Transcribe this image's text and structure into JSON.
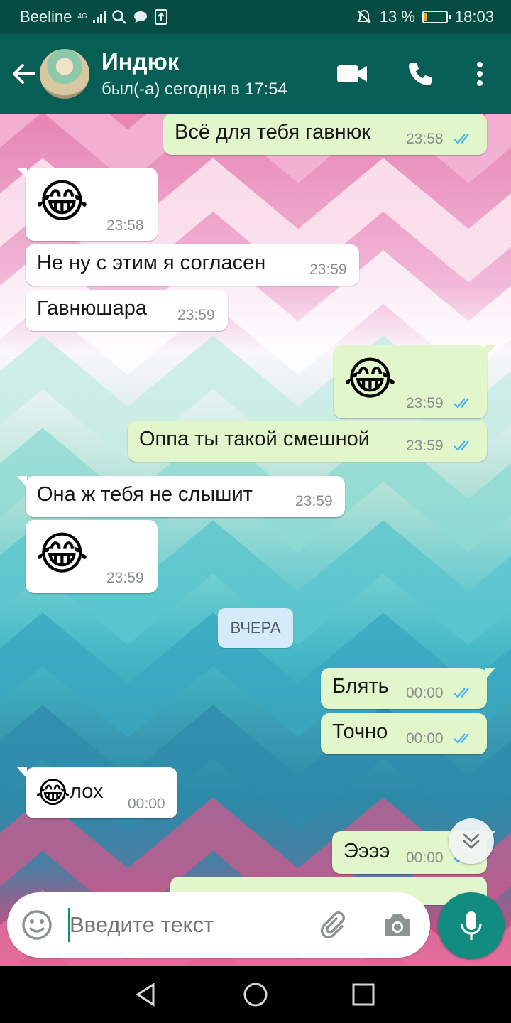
{
  "status_bar": {
    "carrier": "Beeline",
    "network": "4G",
    "battery_percent": "13 %",
    "battery_level": 0.13,
    "time": "18:03"
  },
  "header": {
    "contact_name": "Индюк",
    "contact_status": "был(-а) сегодня в 17:54",
    "icons": [
      "back-arrow-icon",
      "video-call-icon",
      "phone-call-icon",
      "more-vert-icon"
    ]
  },
  "messages": [
    {
      "dir": "out",
      "text": "Всё для тебя гавнюк",
      "time": "23:58",
      "read": true
    },
    {
      "dir": "in",
      "emoji": "😂",
      "time": "23:58"
    },
    {
      "dir": "in",
      "text": "Не ну с этим я согласен",
      "time": "23:59"
    },
    {
      "dir": "in",
      "text": "Гавнюшара",
      "time": "23:59"
    },
    {
      "dir": "out",
      "emoji": "😂",
      "time": "23:59",
      "read": true
    },
    {
      "dir": "out",
      "text": "Оппа ты такой смешной",
      "time": "23:59",
      "read": true
    },
    {
      "dir": "in",
      "text": "Она ж тебя не слышит",
      "time": "23:59"
    },
    {
      "dir": "in",
      "emoji": "😂",
      "time": "23:59"
    },
    {
      "dir": "out",
      "text": "Блять",
      "time": "00:00",
      "read": true
    },
    {
      "dir": "out",
      "text": "Точно",
      "time": "00:00",
      "read": true
    },
    {
      "dir": "in",
      "emoji": "😂",
      "text": "лох",
      "time": "00:00"
    },
    {
      "dir": "out",
      "text": "Ээээ",
      "time": "00:00",
      "read": true
    }
  ],
  "date_divider": "ВЧЕРА",
  "composer": {
    "placeholder": "Введите текст",
    "value": ""
  },
  "colors": {
    "header": "#075e54",
    "status_bar": "#054d44",
    "outgoing_bubble": "#e1f6cb",
    "incoming_bubble": "#ffffff",
    "read_ticks": "#4fb6ec",
    "accent": "#128c7e"
  }
}
